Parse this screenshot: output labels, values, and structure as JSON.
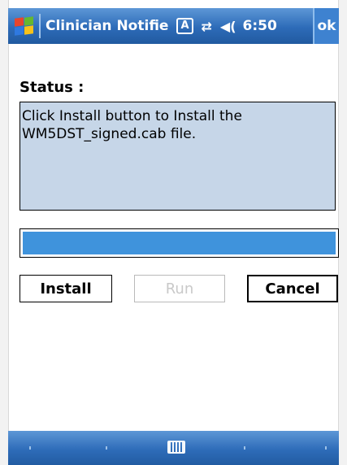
{
  "titlebar": {
    "app_title": "Clinician Notifie",
    "clock": "6:50",
    "ok_label": "ok",
    "icons": [
      "windows-start-icon",
      "input-mode-icon",
      "connectivity-icon",
      "volume-icon"
    ]
  },
  "status": {
    "label": "Status :",
    "text": "Click Install button to Install the WM5DST_signed.cab file."
  },
  "progress": {
    "value": 1.0,
    "color": "#3f93dc"
  },
  "buttons": {
    "install": "Install",
    "run": "Run",
    "cancel": "Cancel"
  },
  "menubar": {
    "icons": [
      "keyboard-icon"
    ]
  },
  "colors": {
    "bar_blue": "#2d6bb8",
    "status_bg": "#c6d6e8"
  }
}
